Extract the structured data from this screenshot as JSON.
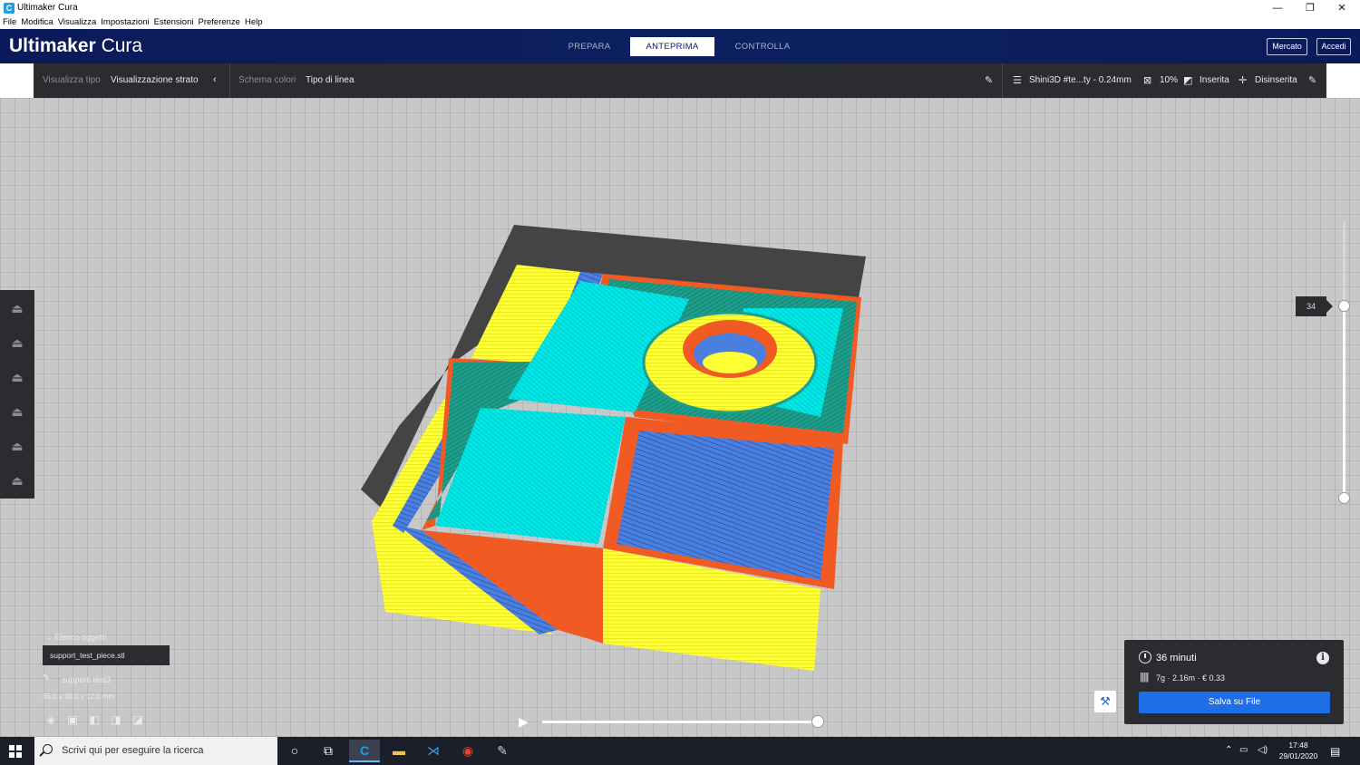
{
  "window": {
    "title": "Ultimaker Cura",
    "controls": {
      "minimize": "—",
      "maximize": "❐",
      "close": "✕"
    }
  },
  "menu": [
    "File",
    "Modifica",
    "Visualizza",
    "Impostazioni",
    "Estensioni",
    "Preferenze",
    "Help"
  ],
  "header": {
    "brand_bold": "Ultimaker",
    "brand_light": "Cura",
    "stages": [
      "PREPARA",
      "ANTEPRIMA",
      "CONTROLLA"
    ],
    "active_stage": "ANTEPRIMA",
    "marketplace": "Mercato",
    "signin": "Accedi"
  },
  "toolbar": {
    "view_type_label": "Visualizza tipo",
    "view_type_value": "Visualizzazione strato",
    "color_scheme_label": "Schema colori",
    "color_scheme_value": "Tipo di linea",
    "profile": "Shini3D #te...ty - 0.24mm",
    "infill": "10%",
    "support": "Inserita",
    "adhesion": "Disinserita"
  },
  "layer_slider": {
    "current_layer": "34"
  },
  "object_list": {
    "header": "Elenco oggetti",
    "items": [
      "support_test_piece.stl"
    ],
    "job_name": "supporti test3",
    "dimensions": "35.0 x 30.0 x 12.0 mm"
  },
  "print_info": {
    "time": "36 minuti",
    "material": "7g · 2.16m · € 0.33",
    "save_button": "Salva su File"
  },
  "taskbar": {
    "search_placeholder": "Scrivi qui per eseguire la ricerca",
    "time": "17:48",
    "date": "29/01/2020"
  },
  "colors": {
    "header_blue": "#0b1a5a",
    "toolbar_dark": "#2b2c2f",
    "wall_outer": "#f15a22",
    "wall_inner": "#1d9e8a",
    "skin": "#00e5e5",
    "support": "#ffff33",
    "infill": "#4a7fe0",
    "save_button": "#1f6ee8"
  }
}
